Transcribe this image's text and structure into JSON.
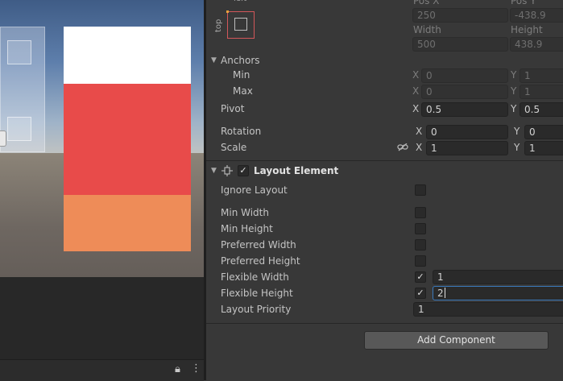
{
  "rect_transform": {
    "top_label": "top",
    "left_label": "left",
    "pos_x_label": "Pos X",
    "pos_y_label": "Pos Y",
    "pos_x": "250",
    "pos_y": "-438.9",
    "width_label": "Width",
    "height_label": "Height",
    "width": "500",
    "height": "438.9",
    "anchors_label": "Anchors",
    "min_label": "Min",
    "max_label": "Max",
    "min_x": "0",
    "min_y": "1",
    "max_x": "0",
    "max_y": "1",
    "pivot_label": "Pivot",
    "pivot_x": "0.5",
    "pivot_y": "0.5",
    "rotation_label": "Rotation",
    "rotation_x": "0",
    "rotation_y": "0",
    "scale_label": "Scale",
    "scale_x": "1",
    "scale_y": "1",
    "x_axis": "X",
    "y_axis": "Y"
  },
  "layout_element": {
    "title": "Layout Element",
    "enabled": true,
    "ignore_layout_label": "Ignore Layout",
    "min_width_label": "Min Width",
    "min_height_label": "Min Height",
    "preferred_width_label": "Preferred Width",
    "preferred_height_label": "Preferred Height",
    "flexible_width_label": "Flexible Width",
    "flexible_width_value": "1",
    "flexible_height_label": "Flexible Height",
    "flexible_height_value": "2",
    "layout_priority_label": "Layout Priority",
    "layout_priority_value": "1"
  },
  "add_component_label": "Add Component",
  "colors": {
    "white_panel": "#ffffff",
    "red_panel": "#e84b4a",
    "orange_panel": "#ee8c58",
    "inspector_bg": "#383838"
  },
  "icons": {
    "fold": "triangle-down",
    "layout": "layout-element-icon",
    "link": "constrain-proportions-icon",
    "lock": "lock-icon",
    "more": "kebab-icon"
  }
}
